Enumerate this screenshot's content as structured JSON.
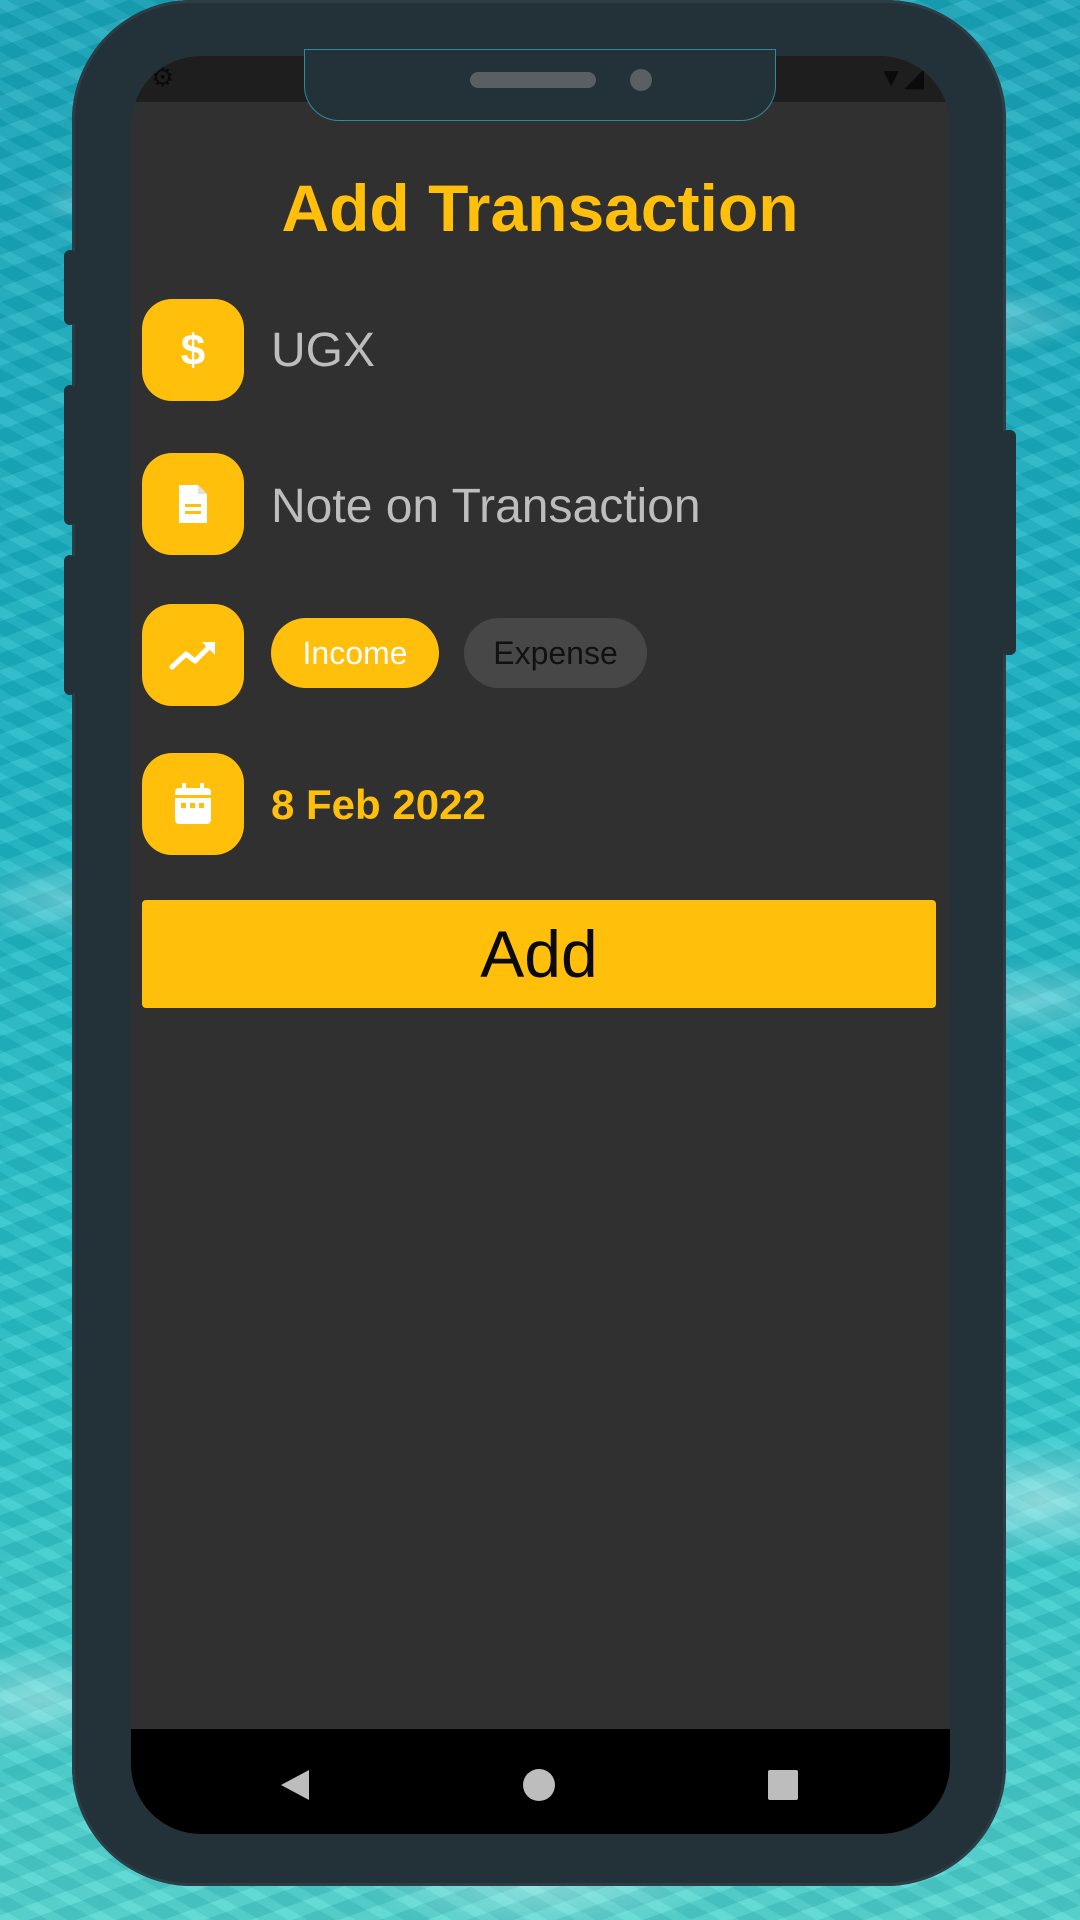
{
  "screen": {
    "title": "Add Transaction"
  },
  "amount": {
    "icon": "dollar-icon",
    "value": "UGX"
  },
  "note": {
    "icon": "document-icon",
    "placeholder": "Note on Transaction"
  },
  "type": {
    "icon": "trending-up-icon",
    "options": [
      "Income",
      "Expense"
    ],
    "selected": "Income"
  },
  "date": {
    "icon": "calendar-icon",
    "value": "8 Feb 2022"
  },
  "actions": {
    "add_label": "Add"
  },
  "navigation": {
    "back_icon": "back-triangle-icon",
    "home_icon": "home-circle-icon",
    "recents_icon": "recents-square-icon"
  },
  "colors": {
    "accent": "#ffbf0a",
    "screen_background": "#303030",
    "frame": "#233138",
    "chip_inactive": "#474747"
  }
}
